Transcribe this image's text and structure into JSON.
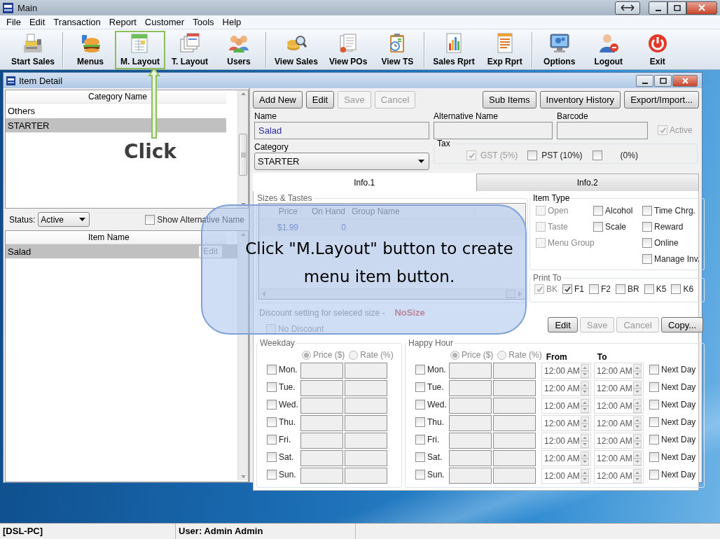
{
  "window": {
    "title": "Main"
  },
  "menu": [
    "File",
    "Edit",
    "Transaction",
    "Report",
    "Customer",
    "Tools",
    "Help"
  ],
  "toolbar": [
    {
      "items": [
        {
          "label": "Start Sales",
          "highlighted": false
        }
      ]
    },
    {
      "items": [
        {
          "label": "Menus",
          "highlighted": false
        },
        {
          "label": "M. Layout",
          "highlighted": true
        },
        {
          "label": "T. Layout",
          "highlighted": false
        },
        {
          "label": "Users",
          "highlighted": false
        }
      ]
    },
    {
      "items": [
        {
          "label": "View Sales",
          "highlighted": false
        },
        {
          "label": "View POs",
          "highlighted": false
        },
        {
          "label": "View TS",
          "highlighted": false
        }
      ]
    },
    {
      "items": [
        {
          "label": "Sales Rprt",
          "highlighted": false
        },
        {
          "label": "Exp Rprt",
          "highlighted": false
        }
      ]
    },
    {
      "items": [
        {
          "label": "Options",
          "highlighted": false
        },
        {
          "label": "Logout",
          "highlighted": false
        },
        {
          "label": "Exit",
          "highlighted": false
        }
      ]
    }
  ],
  "item_detail": {
    "title": "Item Detail"
  },
  "categories": {
    "header": "Category Name",
    "rows": [
      {
        "name": "Others",
        "selected": false
      },
      {
        "name": "STARTER",
        "selected": true
      }
    ]
  },
  "status_filter": {
    "label": "Status:",
    "value": "Active"
  },
  "show_alternative_name": {
    "label": "Show Alternative Name",
    "checked": false
  },
  "items": {
    "header": "Item Name",
    "rows": [
      {
        "name": "Salad",
        "selected": true,
        "button": "Edit"
      }
    ]
  },
  "actions": [
    {
      "label": "Add New",
      "disabled": false
    },
    {
      "label": "Edit",
      "disabled": false
    },
    {
      "label": "Save",
      "disabled": true
    },
    {
      "label": "Cancel",
      "disabled": true
    }
  ],
  "extra_actions": [
    {
      "label": "Sub Items"
    },
    {
      "label": "Inventory History"
    },
    {
      "label": "Export/Import..."
    }
  ],
  "name": {
    "label": "Name",
    "value": "Salad"
  },
  "alternative_name": {
    "label": "Alternative Name"
  },
  "barcode": {
    "label": "Barcode"
  },
  "active": {
    "label": "Active",
    "checked": true,
    "disabled": true
  },
  "category": {
    "label": "Category",
    "value": "STARTER"
  },
  "tax": {
    "title": "Tax",
    "options": [
      {
        "label": "GST (5%)",
        "checked": true,
        "disabled": true
      },
      {
        "label": "PST (10%)",
        "checked": false,
        "disabled": false
      },
      {
        "label": "(0%)",
        "checked": false,
        "disabled": false
      }
    ]
  },
  "tabs": [
    {
      "label": "Info.1",
      "selected": true
    },
    {
      "label": "Info.2",
      "selected": false
    }
  ],
  "sizes": {
    "title": "Sizes & Tastes",
    "columns": [
      "Price",
      "On Hand",
      "Group Name"
    ],
    "rows": [
      {
        "price": "$1.99",
        "on_hand": "0"
      }
    ]
  },
  "discount": {
    "label": "Discount setting for seleced size -",
    "size": "NoSize"
  },
  "no_discount": {
    "label": "No Discount",
    "checked": false,
    "disabled": true
  },
  "item_type": {
    "title": "Item Type",
    "options": [
      {
        "label": "Open",
        "checked": false,
        "disabled": true
      },
      {
        "label": "Alcohol",
        "checked": false,
        "disabled": false
      },
      {
        "label": "Time Chrg.",
        "checked": false,
        "disabled": false
      },
      {
        "label": "Taste",
        "checked": false,
        "disabled": true
      },
      {
        "label": "Scale",
        "checked": false,
        "disabled": false
      },
      {
        "label": "Reward",
        "checked": false,
        "disabled": false
      },
      {
        "label": "Menu Group",
        "checked": false,
        "disabled": true
      },
      {
        "label": "Online",
        "checked": false,
        "disabled": false
      },
      {
        "label": "Manage Inv.",
        "checked": false,
        "disabled": false
      }
    ]
  },
  "print_to": {
    "title": "Print To",
    "options": [
      {
        "label": "BK",
        "checked": true,
        "disabled": true
      },
      {
        "label": "F1",
        "checked": true,
        "disabled": false
      },
      {
        "label": "F2",
        "checked": false,
        "disabled": false
      },
      {
        "label": "BR",
        "checked": false,
        "disabled": false
      },
      {
        "label": "K5",
        "checked": false,
        "disabled": false
      },
      {
        "label": "K6",
        "checked": false,
        "disabled": false
      }
    ]
  },
  "discount_actions": [
    {
      "label": "Edit",
      "disabled": false
    },
    {
      "label": "Save",
      "disabled": true
    },
    {
      "label": "Cancel",
      "disabled": true
    },
    {
      "label": "Copy...",
      "disabled": false
    }
  ],
  "weekday": {
    "title": "Weekday",
    "modes": [
      {
        "label": "Price ($)",
        "selected": true,
        "disabled": true
      },
      {
        "label": "Rate (%)",
        "selected": false,
        "disabled": true
      }
    ],
    "days": [
      {
        "label": "Mon.",
        "checked": false
      },
      {
        "label": "Tue.",
        "checked": false
      },
      {
        "label": "Wed.",
        "checked": false
      },
      {
        "label": "Thu.",
        "checked": false
      },
      {
        "label": "Fri.",
        "checked": false
      },
      {
        "label": "Sat.",
        "checked": false
      },
      {
        "label": "Sun.",
        "checked": false
      }
    ]
  },
  "happy_hour": {
    "title": "Happy Hour",
    "modes": [
      {
        "label": "Price ($)",
        "selected": true,
        "disabled": true
      },
      {
        "label": "Rate (%)",
        "selected": false,
        "disabled": true
      }
    ],
    "from_label": "From",
    "to_label": "To",
    "days": [
      {
        "label": "Mon.",
        "checked": false,
        "from": "12:00 AM",
        "to": "12:00 AM",
        "next_day": {
          "label": "Next Day",
          "checked": false
        }
      },
      {
        "label": "Tue.",
        "checked": false,
        "from": "12:00 AM",
        "to": "12:00 AM",
        "next_day": {
          "label": "Next Day",
          "checked": false
        }
      },
      {
        "label": "Wed.",
        "checked": false,
        "from": "12:00 AM",
        "to": "12:00 AM",
        "next_day": {
          "label": "Next Day",
          "checked": false
        }
      },
      {
        "label": "Thu.",
        "checked": false,
        "from": "12:00 AM",
        "to": "12:00 AM",
        "next_day": {
          "label": "Next Day",
          "checked": false
        }
      },
      {
        "label": "Fri.",
        "checked": false,
        "from": "12:00 AM",
        "to": "12:00 AM",
        "next_day": {
          "label": "Next Day",
          "checked": false
        }
      },
      {
        "label": "Sat.",
        "checked": false,
        "from": "12:00 AM",
        "to": "12:00 AM",
        "next_day": {
          "label": "Next Day",
          "checked": false
        }
      },
      {
        "label": "Sun.",
        "checked": false,
        "from": "12:00 AM",
        "to": "12:00 AM",
        "next_day": {
          "label": "Next Day",
          "checked": false
        }
      }
    ]
  },
  "annotations": {
    "pointer_label": "Click",
    "callout": "Click \"M.Layout\" button to create menu item button."
  },
  "status_bar": [
    "[DSL-PC]",
    "User: Admin Admin"
  ]
}
